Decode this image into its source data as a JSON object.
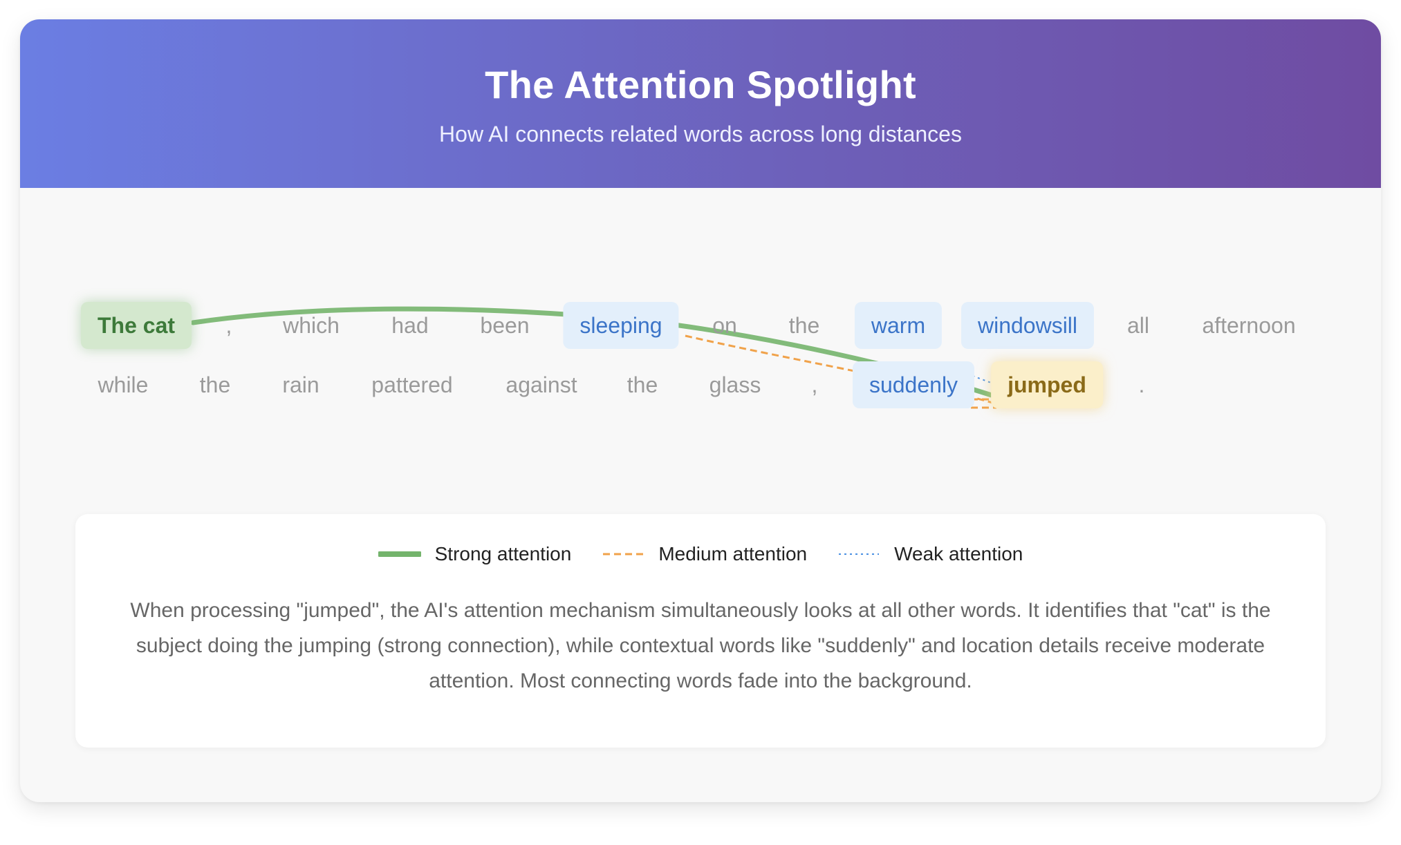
{
  "header": {
    "title": "The Attention Spotlight",
    "subtitle": "How AI connects related words across long distances"
  },
  "tokens": {
    "the_cat": "The cat",
    "comma1": ",",
    "which": "which",
    "had": "had",
    "been": "been",
    "sleeping": "sleeping",
    "on": "on",
    "the1": "the",
    "warm": "warm",
    "windowsill": "windowsill",
    "all": "all",
    "afternoon": "afternoon",
    "while": "while",
    "the2": "the",
    "rain": "rain",
    "pattered": "pattered",
    "against": "against",
    "the3": "the",
    "glass": "glass",
    "comma2": ",",
    "suddenly": "suddenly",
    "jumped": "jumped",
    "period": "."
  },
  "connections": [
    {
      "from": "the_cat",
      "to": "jumped",
      "strength": "strong"
    },
    {
      "from": "sleeping",
      "to": "jumped",
      "strength": "medium"
    },
    {
      "from": "suddenly",
      "to": "jumped",
      "strength": "medium"
    },
    {
      "from": "warm",
      "to": "jumped",
      "strength": "weak"
    },
    {
      "from": "windowsill",
      "to": "jumped",
      "strength": "weak"
    }
  ],
  "colors": {
    "strong": "#74b46c",
    "medium": "#f0a24a",
    "weak": "#4a90e2"
  },
  "legend": {
    "strong": "Strong attention",
    "medium": "Medium attention",
    "weak": "Weak attention"
  },
  "description": "When processing \"jumped\", the AI's attention mechanism simultaneously looks at all other words. It identifies that \"cat\" is the subject doing the jumping (strong connection), while contextual words like \"suddenly\" and location details receive moderate attention. Most connecting words fade into the background."
}
